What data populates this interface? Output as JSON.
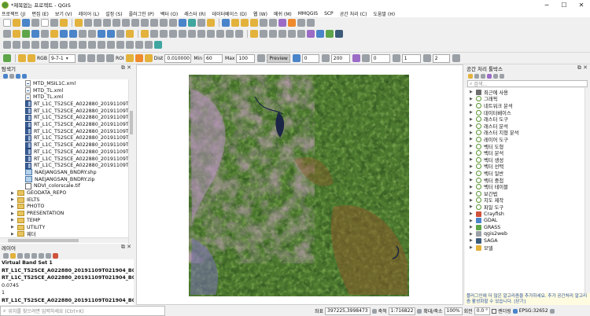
{
  "window": {
    "title": "*제목없는 프로젝트 - QGIS"
  },
  "menu": [
    "프로젝트 (J)",
    "편집 (E)",
    "보기 (V)",
    "레이어 (L)",
    "설정 (S)",
    "플러그인 (P)",
    "벡터 (O)",
    "래스터 (R)",
    "데이터베이스 (D)",
    "웹 (W)",
    "메쉬 (M)",
    "MMQGIS",
    "SCP",
    "공간 처리 (C)",
    "도움말 (H)"
  ],
  "raster_toolbar": {
    "band_set_label": "RGB",
    "band_combo": "9-7-1",
    "roi_label": "ROI",
    "dist_label": "Dist",
    "dist_value": "0.010000",
    "min_label": "Min",
    "min_value": "60",
    "max_label": "Max",
    "max_value": "100",
    "preview_label": "Preview",
    "t1": "0",
    "t2": "200",
    "t3": "0",
    "t4": "1",
    "t5": "2"
  },
  "browser": {
    "title": "탐색기",
    "items": [
      {
        "label": "MTD_MSIL1C.xml",
        "type": "xml",
        "indent": 1
      },
      {
        "label": "MTD_TL.xml",
        "type": "xml",
        "indent": 1
      },
      {
        "label": "MTD_TL.xml",
        "type": "xml",
        "indent": 1
      },
      {
        "label": "RT_L1C_T52SCE_A022880_20191109T0219(",
        "type": "raster",
        "indent": 1
      },
      {
        "label": "RT_L1C_T52SCE_A022880_20191109T0219(",
        "type": "raster",
        "indent": 1
      },
      {
        "label": "RT_L1C_T52SCE_A022880_20191109T0219(",
        "type": "raster",
        "indent": 1
      },
      {
        "label": "RT_L1C_T52SCE_A022880_20191109T0219(",
        "type": "raster",
        "indent": 1
      },
      {
        "label": "RT_L1C_T52SCE_A022880_20191109T0219(",
        "type": "raster",
        "indent": 1
      },
      {
        "label": "RT_L1C_T52SCE_A022880_20191109T0219(",
        "type": "raster",
        "indent": 1
      },
      {
        "label": "RT_L1C_T52SCE_A022880_20191109T0219(",
        "type": "raster",
        "indent": 1
      },
      {
        "label": "RT_L1C_T52SCE_A022880_20191109T0219(",
        "type": "raster",
        "indent": 1
      },
      {
        "label": "RT_L1C_T52SCE_A022880_20191109T0219(",
        "type": "raster",
        "indent": 1
      },
      {
        "label": "RT_L1C_T52SCE_A022880_20191109T0219(",
        "type": "raster",
        "indent": 1
      },
      {
        "label": "NAEJANGSAN_BNDRY.shp",
        "type": "shp",
        "indent": 1
      },
      {
        "label": "NAEJANGSAN_BNDRY.zip",
        "type": "zip",
        "indent": 1
      },
      {
        "label": "NDVI_colorscale.tif",
        "type": "tif",
        "indent": 1
      },
      {
        "label": "GEODATA_REPO",
        "type": "folder",
        "indent": 0
      },
      {
        "label": "IELTS",
        "type": "folder",
        "indent": 0
      },
      {
        "label": "PHOTO",
        "type": "folder",
        "indent": 0
      },
      {
        "label": "PRESENTATION",
        "type": "folder",
        "indent": 0
      },
      {
        "label": "TEMP",
        "type": "folder",
        "indent": 0
      },
      {
        "label": "UTILITY",
        "type": "folder",
        "indent": 0
      },
      {
        "label": "웨더",
        "type": "folder",
        "indent": 0
      }
    ]
  },
  "layers": {
    "title": "레이어",
    "rows": [
      {
        "text": "Virtual Band Set 1",
        "bold": true
      },
      {
        "text": "RT_L1C_T52SCE_A022880_20191109T021904_B0virt_rast",
        "bold": true
      },
      {
        "text": "RT_L1C_T52SCE_A022880_20191109T021904_B02",
        "bold": true
      },
      {
        "text": "0.0745",
        "bold": false
      },
      {
        "text": "1",
        "bold": false
      },
      {
        "text": "RT_L1C_T52SCE_A022880_20191109T021904_B03",
        "bold": true
      }
    ]
  },
  "locator": {
    "placeholder": "위치를 찾으려면 입력하세요 (Ctrl+K)"
  },
  "toolbox": {
    "title": "공간 처리 툴박스",
    "search_placeholder": "검색...",
    "items": [
      {
        "label": "최근에 사용",
        "icon": "clock"
      },
      {
        "label": "그래픽",
        "icon": "q"
      },
      {
        "label": "네트워크 분석",
        "icon": "q"
      },
      {
        "label": "데이터베이스",
        "icon": "q"
      },
      {
        "label": "래스터 도구",
        "icon": "q"
      },
      {
        "label": "래스터 분석",
        "icon": "q"
      },
      {
        "label": "래스터 지형 분석",
        "icon": "q"
      },
      {
        "label": "레이어 도구",
        "icon": "q"
      },
      {
        "label": "벡터 도형",
        "icon": "q"
      },
      {
        "label": "벡터 분석",
        "icon": "q"
      },
      {
        "label": "벡터 생성",
        "icon": "q"
      },
      {
        "label": "벡터 선택",
        "icon": "q"
      },
      {
        "label": "벡터 일반",
        "icon": "q"
      },
      {
        "label": "벡터 중첩",
        "icon": "q"
      },
      {
        "label": "벡터 테이블",
        "icon": "q"
      },
      {
        "label": "보간법",
        "icon": "q"
      },
      {
        "label": "지도 제작",
        "icon": "q"
      },
      {
        "label": "파일 도구",
        "icon": "q"
      },
      {
        "label": "Crayfish",
        "icon": "crayfish"
      },
      {
        "label": "GDAL",
        "icon": "gdal"
      },
      {
        "label": "GRASS",
        "icon": "grass"
      },
      {
        "label": "qgis2web",
        "icon": "web"
      },
      {
        "label": "SAGA",
        "icon": "saga"
      },
      {
        "label": "모델",
        "icon": "model"
      }
    ],
    "tip": "플러그인에 더 많은 알고리즘을 추가하세요. 추가 공간처리 알고리즘 활성화할 수 있습니다. [닫기]"
  },
  "status": {
    "coord_label": "좌표",
    "coord_value": "397225,3998473",
    "scale_label": "축척",
    "scale_value": "1:716822",
    "magnifier_label": "확대/축소",
    "magnifier_value": "100%",
    "rotation_label": "회전",
    "rotation_value": "0.0 °",
    "render_label": "렌더링",
    "crs": "EPSG:32652"
  },
  "colors": {
    "accent": "#589632",
    "veg_dark": "#2f5a22",
    "veg_light": "#6f9a3c",
    "urban": "#c89fbe",
    "water": "#1b2545"
  }
}
